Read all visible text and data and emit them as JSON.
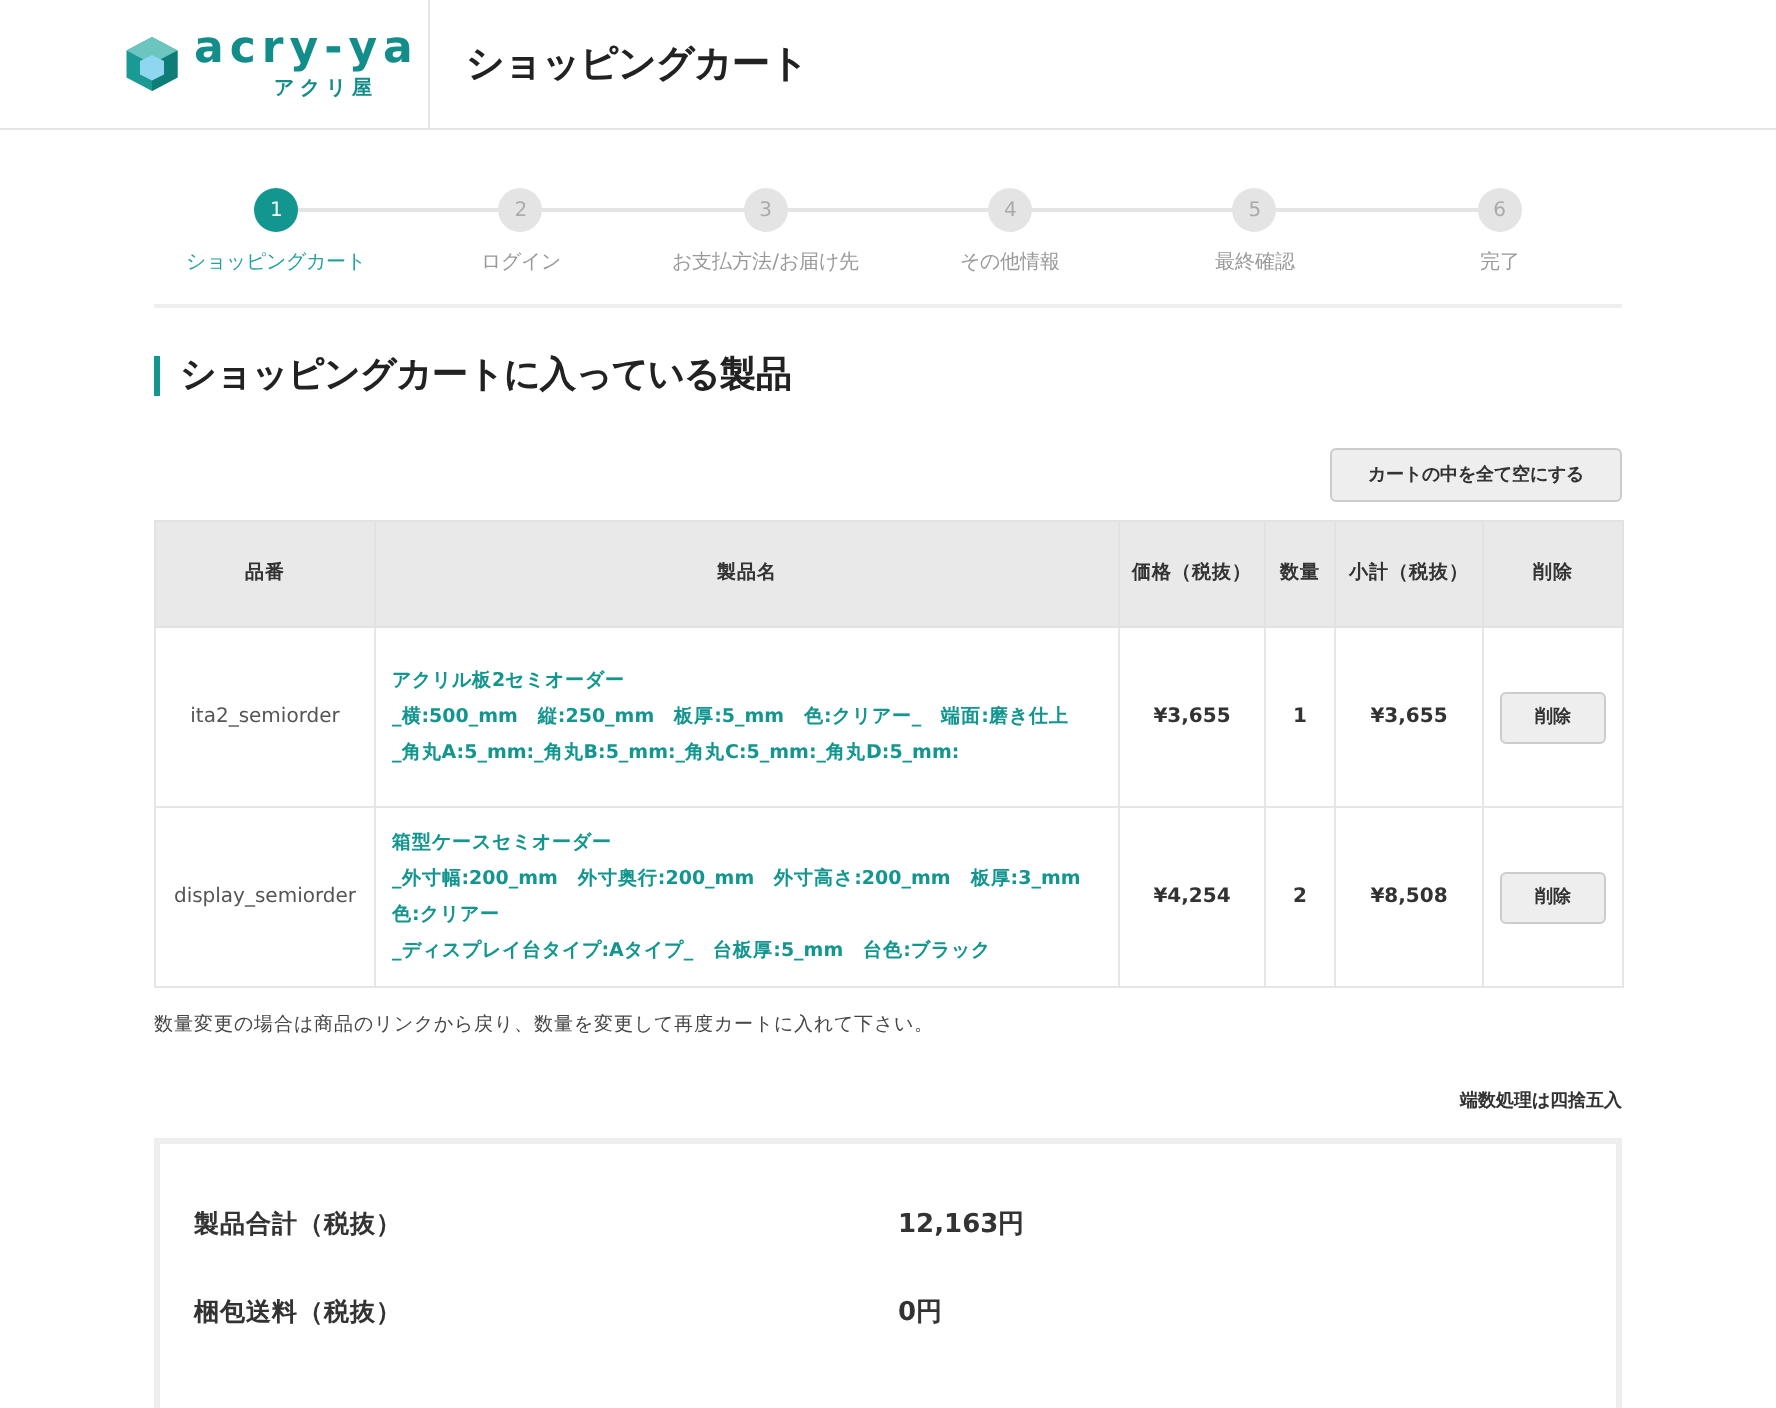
{
  "header": {
    "logo": {
      "name": "acry-ya",
      "sub": "アクリ屋"
    },
    "title": "ショッピングカート"
  },
  "steps": [
    {
      "number": "1",
      "label": "ショッピングカート",
      "selected": true
    },
    {
      "number": "2",
      "label": "ログイン",
      "selected": false
    },
    {
      "number": "3",
      "label": "お支払方法/お届け先",
      "selected": false
    },
    {
      "number": "4",
      "label": "その他情報",
      "selected": false
    },
    {
      "number": "5",
      "label": "最終確認",
      "selected": false
    },
    {
      "number": "6",
      "label": "完了",
      "selected": false
    }
  ],
  "section_title": "ショッピングカートに入っている製品",
  "empty_cart_button": "カートの中を全て空にする",
  "table": {
    "columns": [
      "品番",
      "製品名",
      "価格（税抜）",
      "数量",
      "小計（税抜）",
      "削除"
    ],
    "rows": [
      {
        "code": "ita2_semiorder",
        "name_lines": [
          "アクリル板2セミオーダー",
          "_横:500_mm　縦:250_mm　板厚:5_mm　色:クリアー_　端面:磨き仕上",
          "_角丸A:5_mm:_角丸B:5_mm:_角丸C:5_mm:_角丸D:5_mm:"
        ],
        "price": "¥3,655",
        "quantity": "1",
        "subtotal": "¥3,655",
        "delete": "削除"
      },
      {
        "code": "display_semiorder",
        "name_lines": [
          "箱型ケースセミオーダー",
          "_外寸幅:200_mm　外寸奥行:200_mm　外寸高さ:200_mm　板厚:3_mm　色:クリアー",
          "_ディスプレイ台タイプ:Aタイプ_　台板厚:5_mm　台色:ブラック"
        ],
        "price": "¥4,254",
        "quantity": "2",
        "subtotal": "¥8,508",
        "delete": "削除"
      }
    ]
  },
  "note": "数量変更の場合は商品のリンクから戻り、数量を変更して再度カートに入れて下さい。",
  "rounding_note": "端数処理は四捨五入",
  "summary": [
    {
      "label": "製品合計（税抜）",
      "value": "12,163円"
    },
    {
      "label": "梱包送料（税抜）",
      "value": "0円"
    }
  ]
}
